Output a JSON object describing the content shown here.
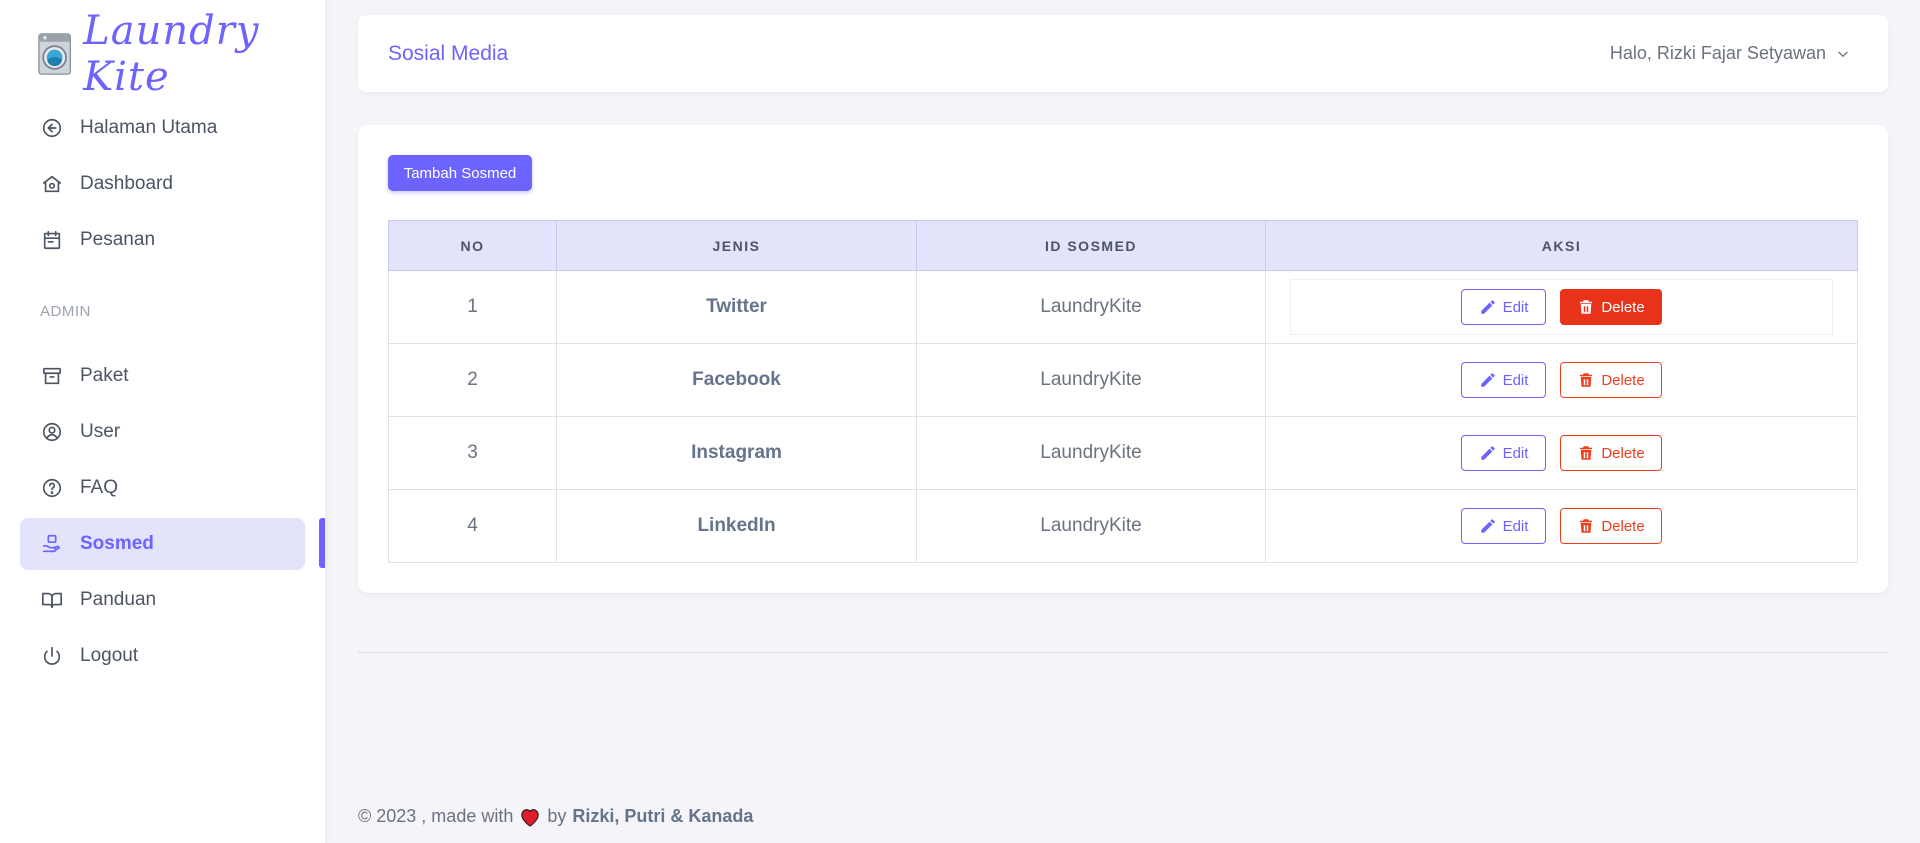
{
  "app": {
    "name": "Laundry Kite"
  },
  "sidebar": {
    "items_top": [
      {
        "label": "Halaman Utama",
        "icon": "arrow-left-circle-icon"
      },
      {
        "label": "Dashboard",
        "icon": "home-icon"
      },
      {
        "label": "Pesanan",
        "icon": "calendar-icon"
      }
    ],
    "section_label": "ADMIN",
    "items_admin": [
      {
        "label": "Paket",
        "icon": "archive-icon"
      },
      {
        "label": "User",
        "icon": "user-circle-icon"
      },
      {
        "label": "FAQ",
        "icon": "help-circle-icon"
      },
      {
        "label": "Sosmed",
        "icon": "hand-icon",
        "active": true
      },
      {
        "label": "Panduan",
        "icon": "book-icon"
      },
      {
        "label": "Logout",
        "icon": "power-icon"
      }
    ]
  },
  "header": {
    "title": "Sosial Media",
    "user_greeting": "Halo, Rizki Fajar Setyawan"
  },
  "main": {
    "add_button_label": "Tambah Sosmed",
    "table": {
      "columns": [
        "NO",
        "JENIS",
        "ID SOSMED",
        "AKSI"
      ],
      "rows": [
        {
          "no": "1",
          "jenis": "Twitter",
          "id_sosmed": "LaundryKite"
        },
        {
          "no": "2",
          "jenis": "Facebook",
          "id_sosmed": "LaundryKite"
        },
        {
          "no": "3",
          "jenis": "Instagram",
          "id_sosmed": "LaundryKite"
        },
        {
          "no": "4",
          "jenis": "LinkedIn",
          "id_sosmed": "LaundryKite"
        }
      ],
      "edit_label": "Edit",
      "delete_label": "Delete"
    }
  },
  "footer": {
    "prefix": "© 2023 , made with",
    "by": "by",
    "authors": "Rizki, Putri & Kanada"
  },
  "colors": {
    "accent": "#6d63ff",
    "accent_light": "#e3e3fb",
    "danger": "#e8331a"
  }
}
